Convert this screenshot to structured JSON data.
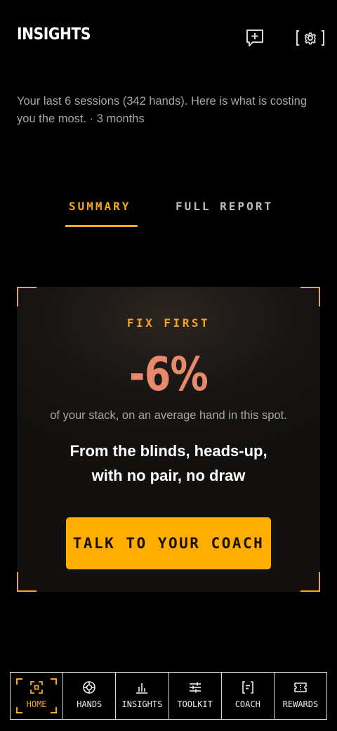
{
  "header": {
    "title": "INSIGHTS",
    "add_icon": "message-plus-icon",
    "settings_icon": "gear-icon"
  },
  "subtitle": "Your last 6 sessions (342 hands). Here is what is costing you the most. · 3 months",
  "tabs": [
    {
      "label": "SUMMARY",
      "active": true
    },
    {
      "label": "FULL REPORT",
      "active": false
    }
  ],
  "card": {
    "eyebrow": "FIX FIRST",
    "big_value": "-6%",
    "caption": "of your stack, on an average hand in this spot.",
    "headline": "From the blinds, heads-up, with no pair, no draw",
    "cta_label": "TALK TO YOUR COACH"
  },
  "nav": {
    "items": [
      {
        "label": "HOME",
        "icon": "focus-target-icon",
        "active": true
      },
      {
        "label": "HANDS",
        "icon": "poker-chip-icon",
        "active": false
      },
      {
        "label": "INSIGHTS",
        "icon": "bar-chart-icon",
        "active": false
      },
      {
        "label": "TOOLKIT",
        "icon": "sliders-icon",
        "active": false
      },
      {
        "label": "COACH",
        "icon": "chat-bracket-icon",
        "active": false
      },
      {
        "label": "REWARDS",
        "icon": "ticket-icon",
        "active": false
      }
    ]
  },
  "colors": {
    "accent": "#f5a623",
    "cta": "#ffae00",
    "big_value": "#e8896b",
    "background": "#000000"
  }
}
